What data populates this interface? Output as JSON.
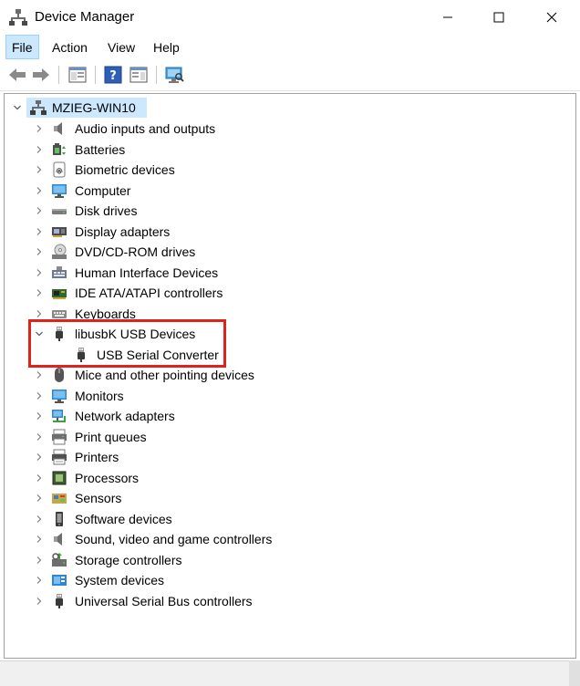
{
  "window": {
    "title": "Device Manager"
  },
  "menu": {
    "file": "File",
    "action": "Action",
    "view": "View",
    "help": "Help"
  },
  "tree": {
    "root": "MZIEG-WIN10",
    "categories": [
      {
        "label": "Audio inputs and outputs",
        "icon": "speaker-icon"
      },
      {
        "label": "Batteries",
        "icon": "battery-icon"
      },
      {
        "label": "Biometric devices",
        "icon": "fingerprint-icon"
      },
      {
        "label": "Computer",
        "icon": "monitor-icon"
      },
      {
        "label": "Disk drives",
        "icon": "disk-drive-icon"
      },
      {
        "label": "Display adapters",
        "icon": "display-adapter-icon"
      },
      {
        "label": "DVD/CD-ROM drives",
        "icon": "dvd-icon"
      },
      {
        "label": "Human Interface Devices",
        "icon": "hid-icon"
      },
      {
        "label": "IDE ATA/ATAPI controllers",
        "icon": "ide-controller-icon"
      },
      {
        "label": "Keyboards",
        "icon": "keyboard-icon"
      },
      {
        "label": "libusbK USB Devices",
        "icon": "usb-plug-icon",
        "expanded": true,
        "children": [
          {
            "label": "USB Serial Converter",
            "icon": "usb-plug-icon"
          }
        ]
      },
      {
        "label": "Mice and other pointing devices",
        "icon": "mouse-icon"
      },
      {
        "label": "Monitors",
        "icon": "monitor-icon"
      },
      {
        "label": "Network adapters",
        "icon": "network-icon"
      },
      {
        "label": "Print queues",
        "icon": "print-queue-icon"
      },
      {
        "label": "Printers",
        "icon": "printer-icon"
      },
      {
        "label": "Processors",
        "icon": "processor-icon"
      },
      {
        "label": "Sensors",
        "icon": "sensor-icon"
      },
      {
        "label": "Software devices",
        "icon": "software-device-icon"
      },
      {
        "label": "Sound, video and game controllers",
        "icon": "speaker-icon"
      },
      {
        "label": "Storage controllers",
        "icon": "storage-controller-icon"
      },
      {
        "label": "System devices",
        "icon": "system-device-icon"
      },
      {
        "label": "Universal Serial Bus controllers",
        "icon": "usb-plug-icon"
      }
    ]
  },
  "colors": {
    "selection": "#cce8ff",
    "highlight_box": "#e0231a",
    "accent": "#2b7bd8"
  }
}
